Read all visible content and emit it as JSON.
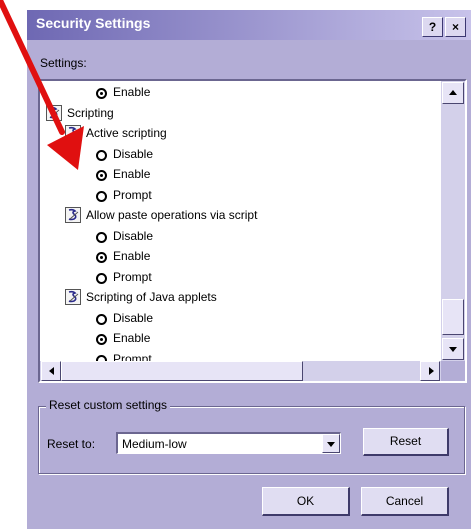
{
  "dialog": {
    "title": "Security Settings",
    "help_button": "?",
    "close_button": "×"
  },
  "settings_label": "Settings:",
  "tree": {
    "rows": [
      {
        "type": "radio",
        "label": "Enable",
        "checked": true
      },
      {
        "type": "category",
        "label": "Scripting",
        "icon": "script-folder-icon"
      },
      {
        "type": "setting",
        "label": "Active scripting",
        "icon": "script-settings-icon"
      },
      {
        "type": "radio",
        "label": "Disable",
        "checked": false
      },
      {
        "type": "radio",
        "label": "Enable",
        "checked": true
      },
      {
        "type": "radio",
        "label": "Prompt",
        "checked": false
      },
      {
        "type": "setting",
        "label": "Allow paste operations via script",
        "icon": "script-settings-icon"
      },
      {
        "type": "radio",
        "label": "Disable",
        "checked": false
      },
      {
        "type": "radio",
        "label": "Enable",
        "checked": true
      },
      {
        "type": "radio",
        "label": "Prompt",
        "checked": false
      },
      {
        "type": "setting",
        "label": "Scripting of Java applets",
        "icon": "script-settings-icon"
      },
      {
        "type": "radio",
        "label": "Disable",
        "checked": false
      },
      {
        "type": "radio",
        "label": "Enable",
        "checked": true
      },
      {
        "type": "radio",
        "label": "Prompt",
        "checked": false
      }
    ]
  },
  "reset_group": {
    "legend": "Reset custom settings",
    "reset_to_label": "Reset to:",
    "selected_level": "Medium-low",
    "reset_button": "Reset"
  },
  "footer": {
    "ok_button": "OK",
    "cancel_button": "Cancel"
  },
  "colors": {
    "dialog_bg": "#b3add6",
    "annotation_arrow": "#e01010"
  }
}
